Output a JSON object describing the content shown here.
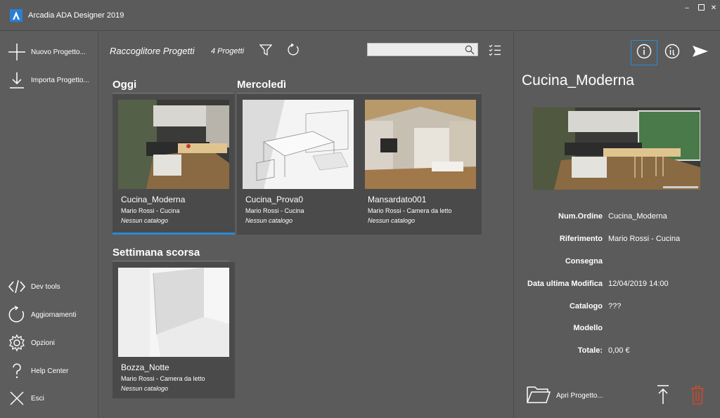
{
  "app": {
    "title": "Arcadia ADA Designer 2019",
    "window_controls": [
      "minimize",
      "maximize",
      "close"
    ]
  },
  "sidebar": {
    "top_items": [
      {
        "label": "Nuovo Progetto...",
        "icon": "plus-icon"
      },
      {
        "label": "Importa Progetto...",
        "icon": "import-icon"
      }
    ],
    "bottom_items": [
      {
        "label": "Dev tools",
        "icon": "code-icon"
      },
      {
        "label": "Aggiornamenti",
        "icon": "refresh-icon"
      },
      {
        "label": "Opzioni",
        "icon": "gear-icon"
      },
      {
        "label": "Help Center",
        "icon": "question-icon"
      },
      {
        "label": "Esci",
        "icon": "close-icon"
      }
    ]
  },
  "toolbar": {
    "title": "Raccoglitore Progetti",
    "count": "4 Progetti",
    "search_value": "",
    "icons": [
      "filter-icon",
      "refresh-icon",
      "search-icon",
      "checklist-icon"
    ]
  },
  "groups": [
    {
      "title": "Oggi",
      "cards": [
        {
          "name": "Cucina_Moderna",
          "subtitle": "Mario Rossi - Cucina",
          "catalog": "Nessun catalogo",
          "selected": true
        }
      ]
    },
    {
      "title": "Mercoledì",
      "cards": [
        {
          "name": "Cucina_Prova0",
          "subtitle": "Mario Rossi - Cucina",
          "catalog": "Nessun catalogo",
          "selected": false
        },
        {
          "name": "Mansardato001",
          "subtitle": "Mario Rossi - Camera da letto",
          "catalog": "Nessun catalogo",
          "selected": false
        }
      ]
    },
    {
      "title": "Settimana scorsa",
      "cards": [
        {
          "name": "Bozza_Notte",
          "subtitle": "Mario Rossi - Camera da letto",
          "catalog": "Nessun catalogo",
          "selected": false
        }
      ]
    }
  ],
  "detail": {
    "title": "Cucina_Moderna",
    "header_icons": [
      "info-icon",
      "info-list-icon",
      "send-icon"
    ],
    "properties": [
      {
        "label": "Num.Ordine",
        "value": "Cucina_Moderna"
      },
      {
        "label": "Riferimento",
        "value": "Mario Rossi - Cucina"
      },
      {
        "label": "Consegna",
        "value": ""
      },
      {
        "label": "Data ultima Modifica",
        "value": "12/04/2019 14:00"
      },
      {
        "label": "Catalogo",
        "value": "???"
      },
      {
        "label": "Modello",
        "value": ""
      },
      {
        "label": "Totale:",
        "value": "0,00 €"
      }
    ],
    "open_label": "Apri Progetto...",
    "actions": [
      "export-icon",
      "trash-icon"
    ]
  },
  "colors": {
    "background": "#5b5b5b",
    "card": "#4a4a4a",
    "accent": "#2a8ad8",
    "delete": "#d04a2a"
  }
}
